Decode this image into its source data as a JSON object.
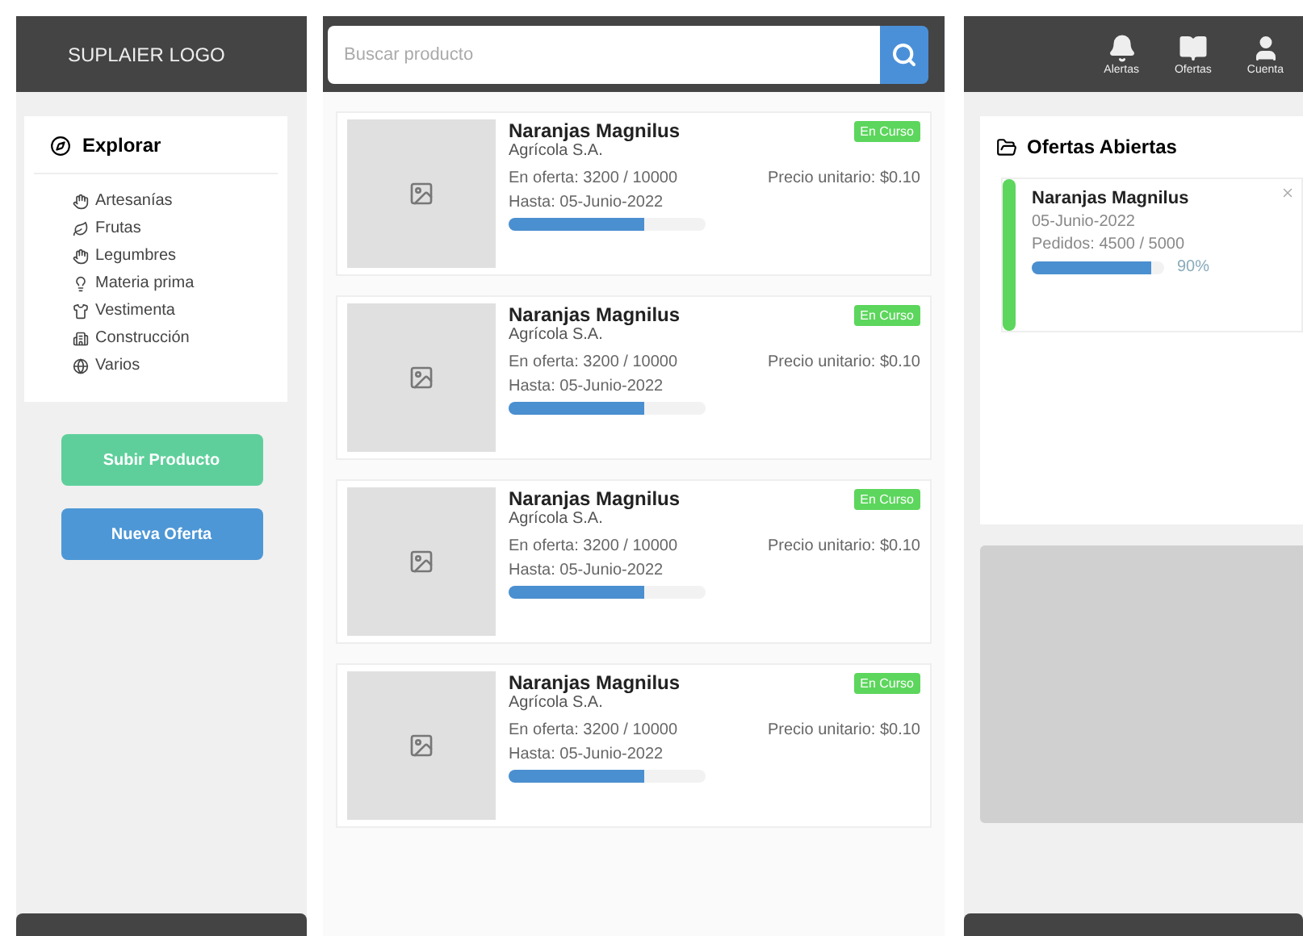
{
  "header": {
    "logo": "SUPLAIER LOGO",
    "search": {
      "placeholder": "Buscar producto"
    },
    "nav": [
      {
        "label": "Alertas"
      },
      {
        "label": "Ofertas"
      },
      {
        "label": "Cuenta"
      }
    ]
  },
  "sidebar": {
    "title": "Explorar",
    "items": [
      {
        "label": "Artesanías"
      },
      {
        "label": "Frutas"
      },
      {
        "label": "Legumbres"
      },
      {
        "label": "Materia prima"
      },
      {
        "label": "Vestimenta"
      },
      {
        "label": "Construcción"
      },
      {
        "label": "Varios"
      }
    ],
    "buttons": [
      {
        "label": "Subir Producto",
        "kind": "upload"
      },
      {
        "label": "Nueva Oferta",
        "kind": "offer"
      }
    ]
  },
  "products": [
    {
      "name": "Naranjas Magnilus",
      "company": "Agrícola S.A.",
      "status": "En Curso",
      "offer": "En oferta: 3200 / 10000",
      "price": "Precio unitario: $0.10",
      "until": "Hasta: 05-Junio-2022",
      "level": 0.69
    },
    {
      "name": "Naranjas Magnilus",
      "company": "Agrícola S.A.",
      "status": "En Curso",
      "offer": "En oferta: 3200 / 10000",
      "price": "Precio unitario: $0.10",
      "until": "Hasta: 05-Junio-2022",
      "level": 0.69
    },
    {
      "name": "Naranjas Magnilus",
      "company": "Agrícola S.A.",
      "status": "En Curso",
      "offer": "En oferta: 3200 / 10000",
      "price": "Precio unitario: $0.10",
      "until": "Hasta: 05-Junio-2022",
      "level": 0.69
    },
    {
      "name": "Naranjas Magnilus",
      "company": "Agrícola S.A.",
      "status": "En Curso",
      "offer": "En oferta: 3200 / 10000",
      "price": "Precio unitario: $0.10",
      "until": "Hasta: 05-Junio-2022",
      "level": 0.69
    }
  ],
  "open_offers": {
    "title": "Ofertas Abiertas",
    "items": [
      {
        "name": "Naranjas Magnilus",
        "date": "05-Junio-2022",
        "orders": "Pedidos: 4500 / 5000",
        "level": 0.9,
        "percent": "90%",
        "color": "#5cd65c"
      }
    ]
  }
}
